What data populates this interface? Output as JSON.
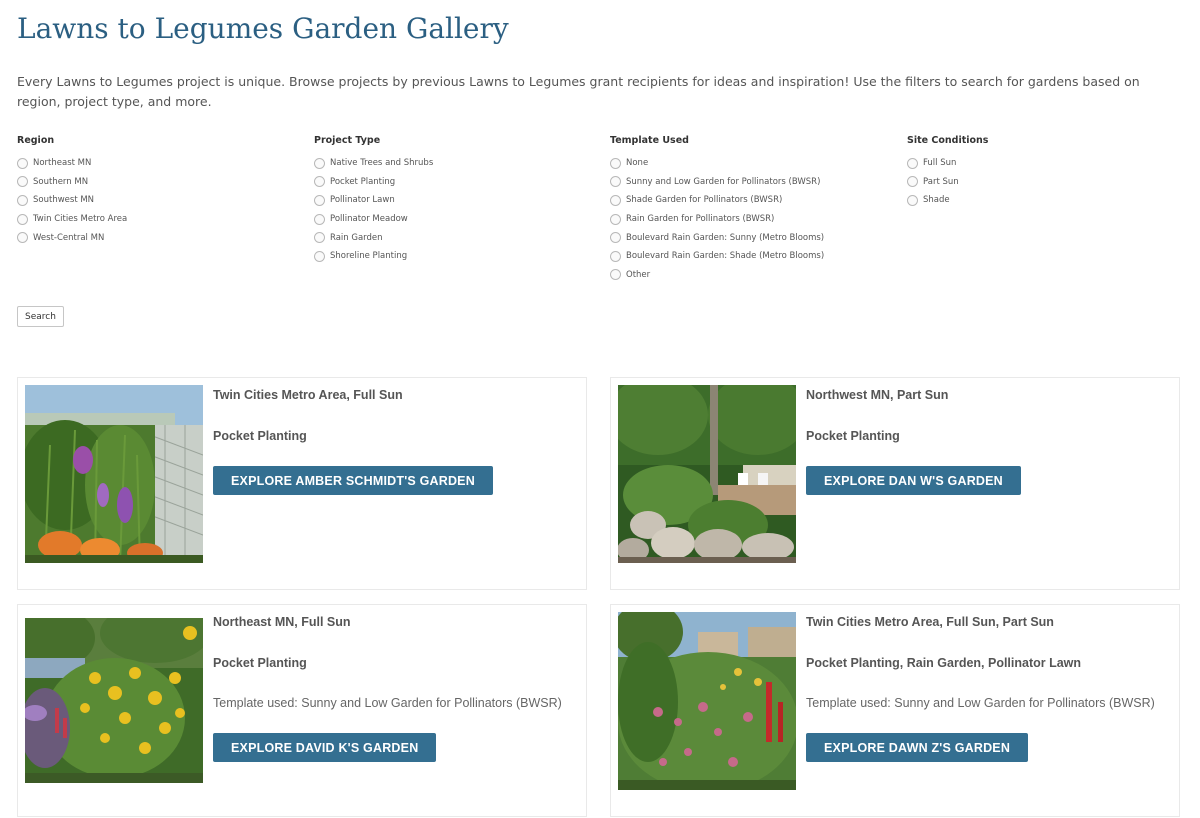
{
  "page": {
    "title": "Lawns to Legumes Garden Gallery",
    "intro": "Every Lawns to Legumes project is unique. Browse projects by previous Lawns to Legumes grant recipients for ideas and inspiration! Use the filters to search for gardens based on region, project type, and more."
  },
  "filters": {
    "region": {
      "title": "Region",
      "options": [
        "Northeast MN",
        "Southern MN",
        "Southwest MN",
        "Twin Cities Metro Area",
        "West-Central MN"
      ]
    },
    "project_type": {
      "title": "Project Type",
      "options": [
        "Native Trees and Shrubs",
        "Pocket Planting",
        "Pollinator Lawn",
        "Pollinator Meadow",
        "Rain Garden",
        "Shoreline Planting"
      ]
    },
    "template": {
      "title": "Template Used",
      "options": [
        "None",
        "Sunny and Low Garden for Pollinators (BWSR)",
        "Shade Garden for Pollinators (BWSR)",
        "Rain Garden for Pollinators (BWSR)",
        "Boulevard Rain Garden: Sunny (Metro Blooms)",
        "Boulevard Rain Garden: Shade (Metro Blooms)",
        "Other"
      ]
    },
    "site": {
      "title": "Site Conditions",
      "options": [
        "Full Sun",
        "Part Sun",
        "Shade"
      ]
    },
    "search_label": "Search"
  },
  "cards": [
    {
      "region": "Twin Cities Metro Area, Full Sun",
      "type": "Pocket Planting",
      "template": "",
      "button": "EXPLORE AMBER SCHMIDT'S GARDEN"
    },
    {
      "region": "Northwest MN, Part Sun",
      "type": "Pocket Planting",
      "template": "",
      "button": "EXPLORE DAN W'S GARDEN"
    },
    {
      "region": "Northeast MN, Full Sun",
      "type": "Pocket Planting",
      "template": "Template used: Sunny and Low Garden for Pollinators (BWSR)",
      "button": "EXPLORE DAVID K'S GARDEN"
    },
    {
      "region": "Twin Cities Metro Area, Full Sun, Part Sun",
      "type": "Pocket Planting, Rain Garden, Pollinator Lawn",
      "template": "Template used: Sunny and Low Garden for Pollinators (BWSR)",
      "button": "EXPLORE DAWN Z'S GARDEN"
    }
  ],
  "colors": {
    "title": "#2b5f82",
    "button": "#346f91"
  }
}
